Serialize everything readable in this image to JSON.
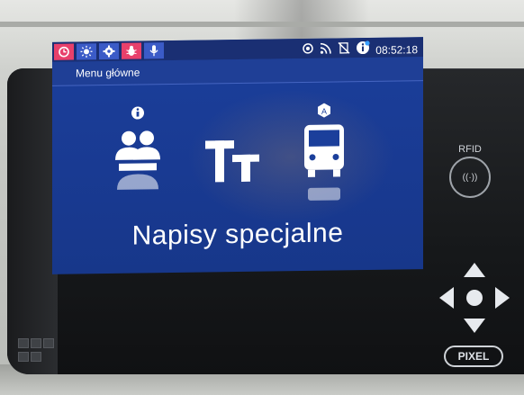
{
  "statusbar": {
    "left_icons": [
      "alarm-icon",
      "brightness-icon",
      "settings-icon",
      "bug-icon",
      "microphone-icon"
    ],
    "right_icons": [
      "gps-icon",
      "rss-icon",
      "no-sim-icon",
      "info-icon"
    ],
    "time": "08:52:18"
  },
  "menu": {
    "title": "Menu główne"
  },
  "tiles": {
    "passengers_icon": "passengers-icon",
    "text_icon": "text-icon",
    "bus_icon": "bus-icon",
    "caption": "Napisy specjalne"
  },
  "device": {
    "rfid_label": "RFID",
    "rfid_symbol": "((·))",
    "brand": "PIXEL"
  },
  "colors": {
    "screen_bg": "#1b3f9b",
    "statusbar_bg": "#1a2f73",
    "icon_pink": "#e8406b",
    "icon_blue": "#3b5bc7"
  }
}
